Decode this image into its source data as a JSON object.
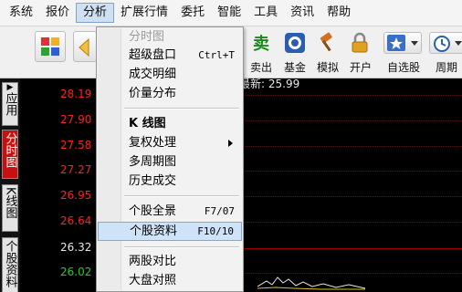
{
  "menubar": {
    "items": [
      "系统",
      "报价",
      "分析",
      "扩展行情",
      "委托",
      "智能",
      "工具",
      "资讯",
      "帮助"
    ]
  },
  "toolbar": {
    "labels": [
      "卖出",
      "基金",
      "模拟",
      "开户",
      "自选股",
      "周期"
    ],
    "sell_glyph": "卖"
  },
  "sidebar": {
    "tabs": [
      "应用",
      "分时图",
      "K线图",
      "个股资料"
    ]
  },
  "chart": {
    "latest": "最新: 25.99",
    "prices": [
      "28.19",
      "27.90",
      "27.58",
      "27.27",
      "26.95",
      "26.64",
      "26.32",
      "26.02"
    ],
    "colors": {
      "up": "#ff2020",
      "base": "#e8e8e8",
      "down": "#20d020"
    }
  },
  "dropdown": {
    "items": [
      {
        "label": "分时图",
        "shortcut": ""
      },
      {
        "label": "超级盘口",
        "shortcut": "Ctrl+T"
      },
      {
        "label": "成交明细",
        "shortcut": ""
      },
      {
        "label": "价量分布",
        "shortcut": ""
      },
      {
        "label": "K 线图",
        "shortcut": ""
      },
      {
        "label": "复权处理",
        "shortcut": ""
      },
      {
        "label": "多周期图",
        "shortcut": ""
      },
      {
        "label": "历史成交",
        "shortcut": ""
      },
      {
        "label": "个股全景",
        "shortcut": "F7/07"
      },
      {
        "label": "个股资料",
        "shortcut": "F10/10"
      },
      {
        "label": "两股对比",
        "shortcut": ""
      },
      {
        "label": "大盘对照",
        "shortcut": ""
      }
    ]
  }
}
